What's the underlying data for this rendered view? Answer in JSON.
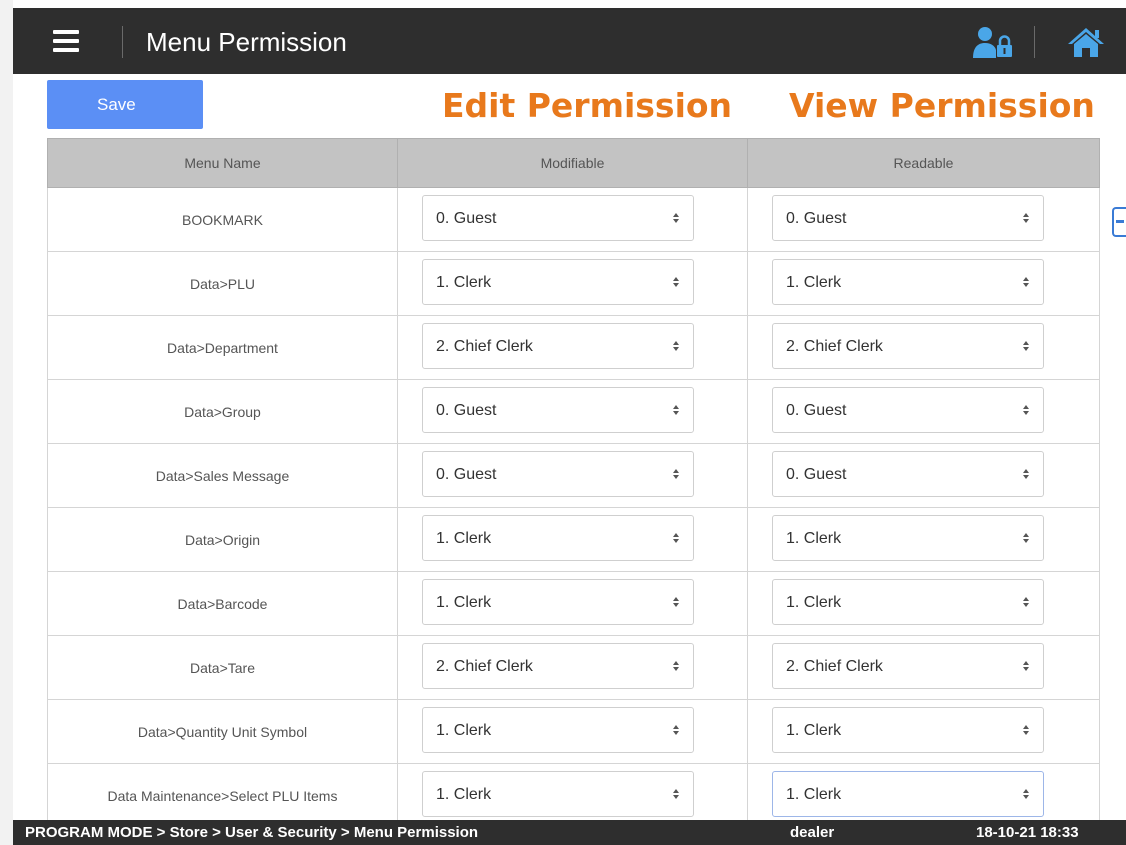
{
  "header": {
    "title": "Menu Permission",
    "menu_icon": "hamburger-icon",
    "user_icon": "user-lock-icon",
    "home_icon": "home-icon",
    "bar_color": "#2e2e2e"
  },
  "toolbar": {
    "save_label": "Save",
    "save_color": "#5b8ff5"
  },
  "annotations": {
    "edit": "Edit Permission",
    "view": "View Permission",
    "color": "#e8791c"
  },
  "table": {
    "headers": [
      "Menu Name",
      "Modifiable",
      "Readable"
    ],
    "rows": [
      {
        "menu": "BOOKMARK",
        "modifiable": "0. Guest",
        "readable": "0. Guest"
      },
      {
        "menu": "Data>PLU",
        "modifiable": "1. Clerk",
        "readable": "1. Clerk"
      },
      {
        "menu": "Data>Department",
        "modifiable": "2. Chief Clerk",
        "readable": "2. Chief Clerk"
      },
      {
        "menu": "Data>Group",
        "modifiable": "0. Guest",
        "readable": "0. Guest"
      },
      {
        "menu": "Data>Sales Message",
        "modifiable": "0. Guest",
        "readable": "0. Guest"
      },
      {
        "menu": "Data>Origin",
        "modifiable": "1. Clerk",
        "readable": "1. Clerk"
      },
      {
        "menu": "Data>Barcode",
        "modifiable": "1. Clerk",
        "readable": "1. Clerk"
      },
      {
        "menu": "Data>Tare",
        "modifiable": "2. Chief Clerk",
        "readable": "2. Chief Clerk"
      },
      {
        "menu": "Data>Quantity Unit Symbol",
        "modifiable": "1. Clerk",
        "readable": "1. Clerk"
      },
      {
        "menu": "Data Maintenance>Select PLU Items",
        "modifiable": "1. Clerk",
        "readable": "1. Clerk"
      }
    ]
  },
  "status": {
    "path": "PROGRAM MODE > Store > User & Security > Menu Permission",
    "user": "dealer",
    "datetime": "18-10-21 18:33"
  }
}
